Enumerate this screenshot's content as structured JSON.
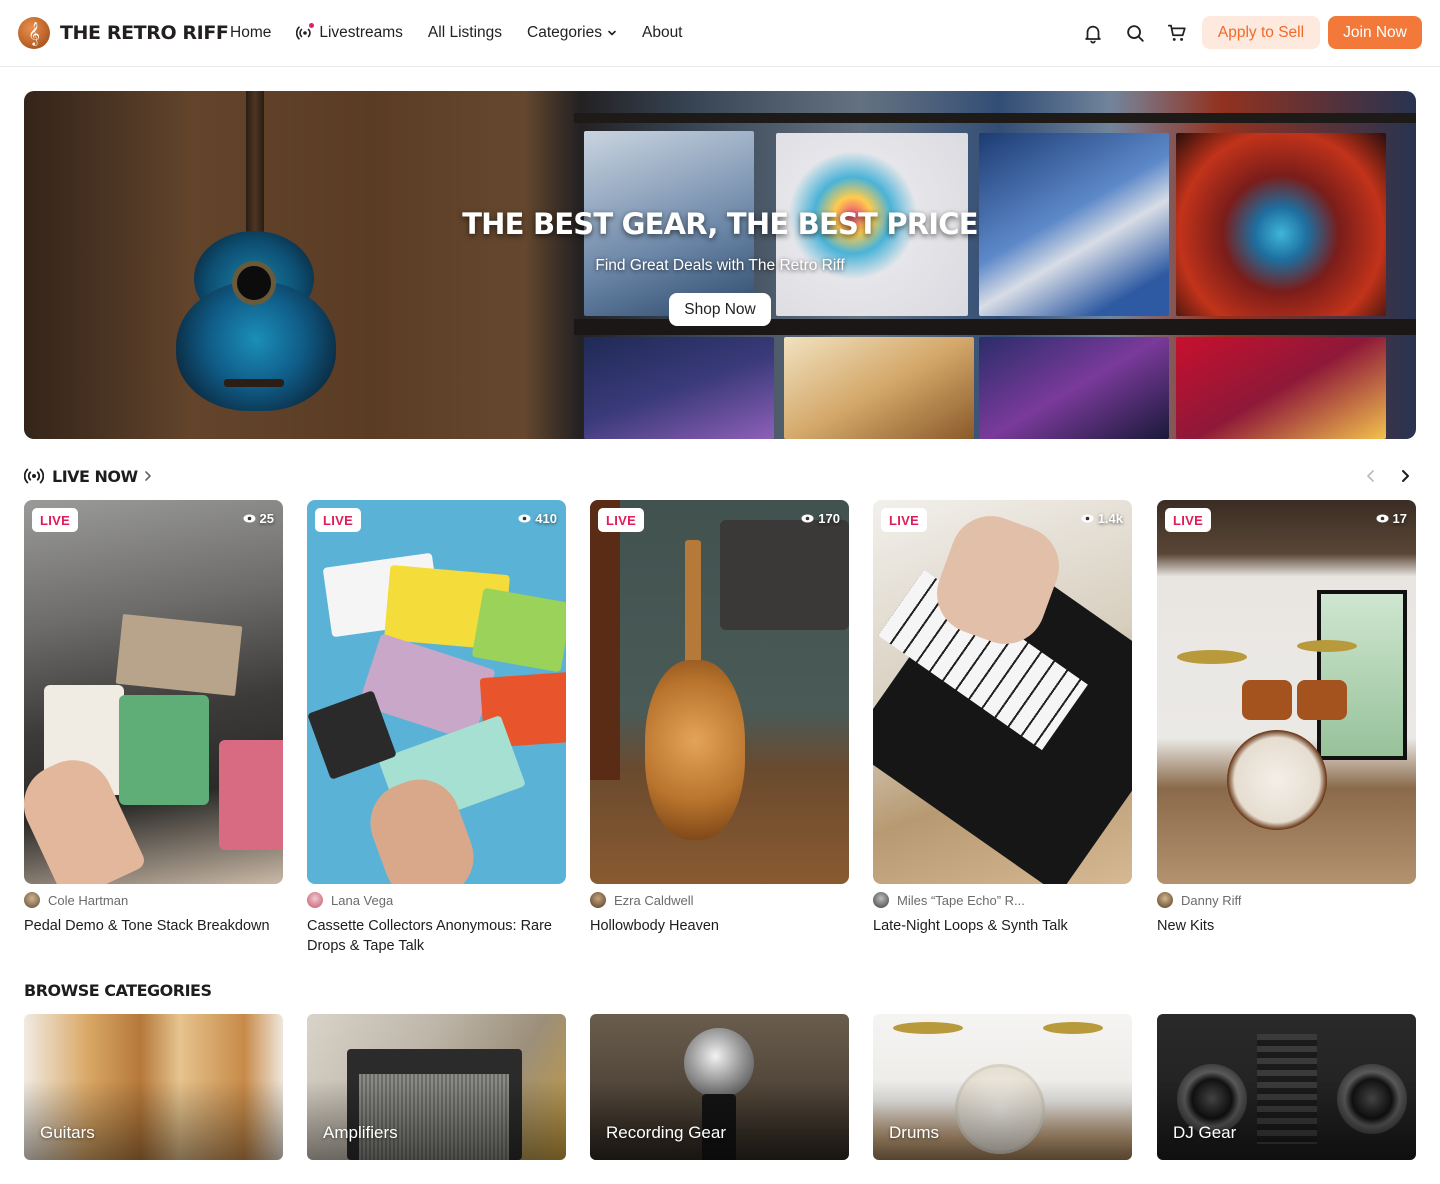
{
  "brand": {
    "name": "THE RETRO RIFF",
    "logo_icon": "treble-clef-icon",
    "accent": "#f2793a"
  },
  "nav": {
    "home": "Home",
    "livestreams": "Livestreams",
    "all_listings": "All Listings",
    "categories": "Categories",
    "about": "About"
  },
  "header_actions": {
    "icons": [
      "bell-icon",
      "search-icon",
      "cart-icon"
    ],
    "apply_label": "Apply to Sell",
    "join_label": "Join Now"
  },
  "hero": {
    "title": "THE BEST GEAR, THE BEST PRICE",
    "subtitle": "Find Great Deals with The Retro Riff",
    "cta": "Shop Now"
  },
  "live_now": {
    "title": "LIVE NOW",
    "badge": "LIVE",
    "streams": [
      {
        "viewers": "25",
        "streamer": "Cole Hartman",
        "title": "Pedal Demo & Tone Stack Breakdown"
      },
      {
        "viewers": "410",
        "streamer": "Lana Vega",
        "title": "Cassette Collectors Anonymous: Rare Drops & Tape Talk"
      },
      {
        "viewers": "170",
        "streamer": "Ezra Caldwell",
        "title": "Hollowbody Heaven"
      },
      {
        "viewers": "1.4k",
        "streamer": "Miles “Tape Echo” R...",
        "title": "Late-Night Loops & Synth Talk"
      },
      {
        "viewers": "17",
        "streamer": "Danny Riff",
        "title": "New Kits"
      }
    ]
  },
  "browse": {
    "title": "BROWSE CATEGORIES",
    "categories": [
      "Guitars",
      "Amplifiers",
      "Recording Gear",
      "Drums",
      "DJ Gear"
    ]
  }
}
